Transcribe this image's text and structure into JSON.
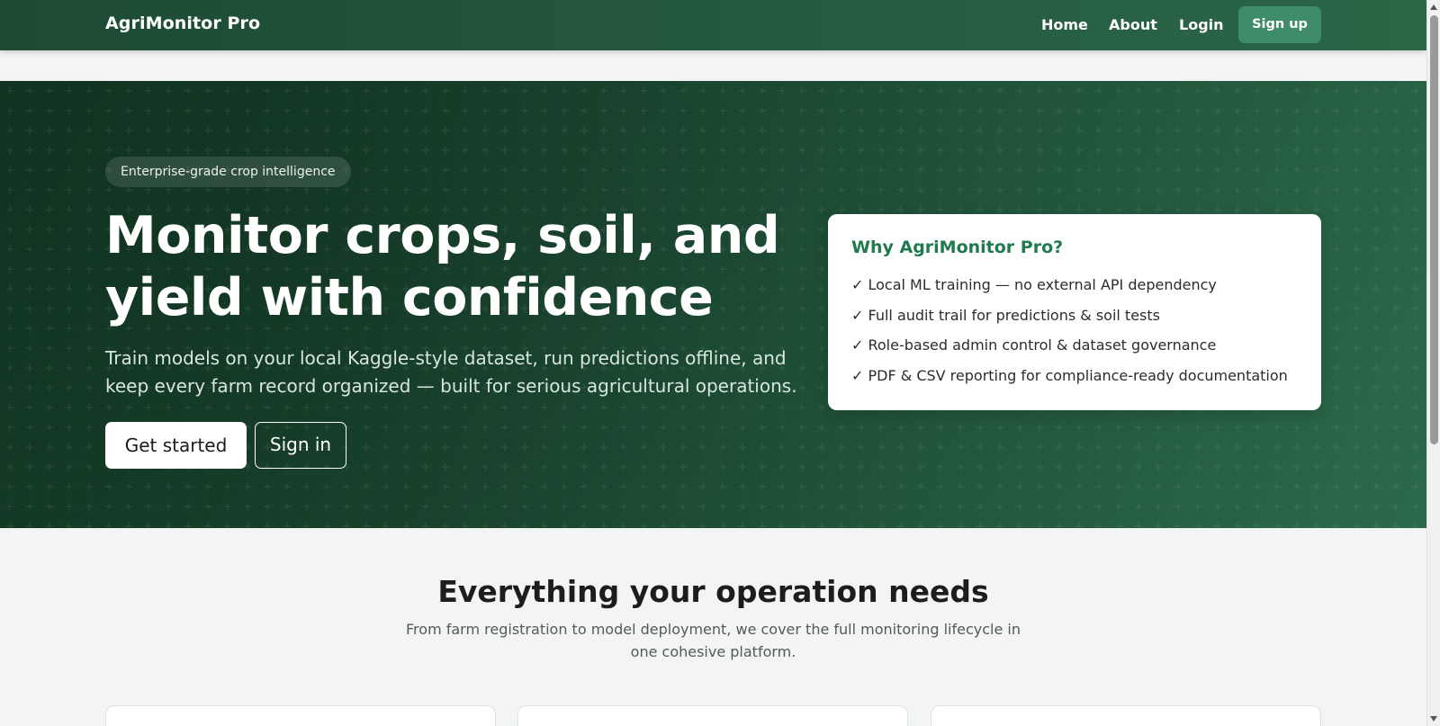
{
  "navbar": {
    "brand": "AgriMonitor Pro",
    "links": [
      "Home",
      "About",
      "Login"
    ],
    "signup_label": "Sign up"
  },
  "hero": {
    "badge": "Enterprise-grade crop intelligence",
    "title": "Monitor crops, soil, and yield with confidence",
    "subtitle": "Train models on your local Kaggle-style dataset, run predictions offline, and keep every farm record organized — built for serious agricultural operations.",
    "primary_button": "Get started",
    "secondary_button": "Sign in"
  },
  "why_card": {
    "title": "Why AgriMonitor Pro?",
    "items": [
      "✓ Local ML training — no external API dependency",
      "✓ Full audit trail for predictions & soil tests",
      "✓ Role-based admin control & dataset governance",
      "✓ PDF & CSV reporting for compliance-ready documentation"
    ]
  },
  "features_section": {
    "title": "Everything your operation needs",
    "subtitle": "From farm registration to model deployment, we cover the full monitoring lifecycle in one cohesive platform."
  },
  "colors": {
    "nav_bg": "#255a3f",
    "hero_dark": "#123824",
    "accent_green": "#1f7a4d",
    "signup_bg": "#3f8d68"
  }
}
